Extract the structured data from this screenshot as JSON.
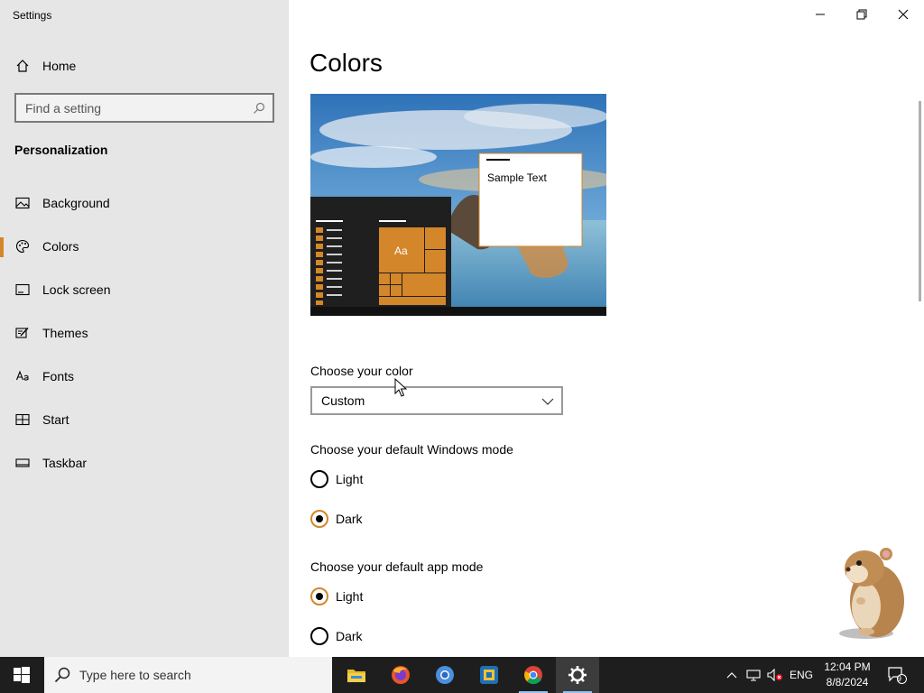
{
  "app": {
    "title": "Settings"
  },
  "window_controls": {
    "minimize": "minimize-icon",
    "restore": "restore-icon",
    "close": "close-icon"
  },
  "sidebar": {
    "home_label": "Home",
    "search_placeholder": "Find a setting",
    "section_title": "Personalization",
    "items": [
      {
        "label": "Background",
        "icon": "picture-icon"
      },
      {
        "label": "Colors",
        "icon": "palette-icon",
        "active": true
      },
      {
        "label": "Lock screen",
        "icon": "lock-screen-icon"
      },
      {
        "label": "Themes",
        "icon": "themes-icon"
      },
      {
        "label": "Fonts",
        "icon": "fonts-icon"
      },
      {
        "label": "Start",
        "icon": "start-icon"
      },
      {
        "label": "Taskbar",
        "icon": "taskbar-icon"
      }
    ]
  },
  "main": {
    "title": "Colors",
    "preview": {
      "sample_text": "Sample Text",
      "tile_text": "Aa"
    },
    "color_select": {
      "label": "Choose your color",
      "value": "Custom"
    },
    "windows_mode": {
      "label": "Choose your default Windows mode",
      "options": [
        {
          "label": "Light",
          "checked": false
        },
        {
          "label": "Dark",
          "checked": true
        }
      ]
    },
    "app_mode": {
      "label": "Choose your default app mode",
      "options": [
        {
          "label": "Light",
          "checked": true
        },
        {
          "label": "Dark",
          "checked": false
        }
      ]
    }
  },
  "taskbar": {
    "search_placeholder": "Type here to search",
    "apps": [
      "file-explorer-icon",
      "firefox-icon",
      "chromium-icon",
      "app-icon",
      "chrome-icon",
      "settings-icon"
    ],
    "language": "ENG",
    "time": "12:04 PM",
    "date": "8/8/2024",
    "notification_count": "9"
  },
  "colors": {
    "accent": "#d4862a",
    "sidebar_bg": "#e6e6e6",
    "taskbar_bg": "#1e1e1e"
  }
}
